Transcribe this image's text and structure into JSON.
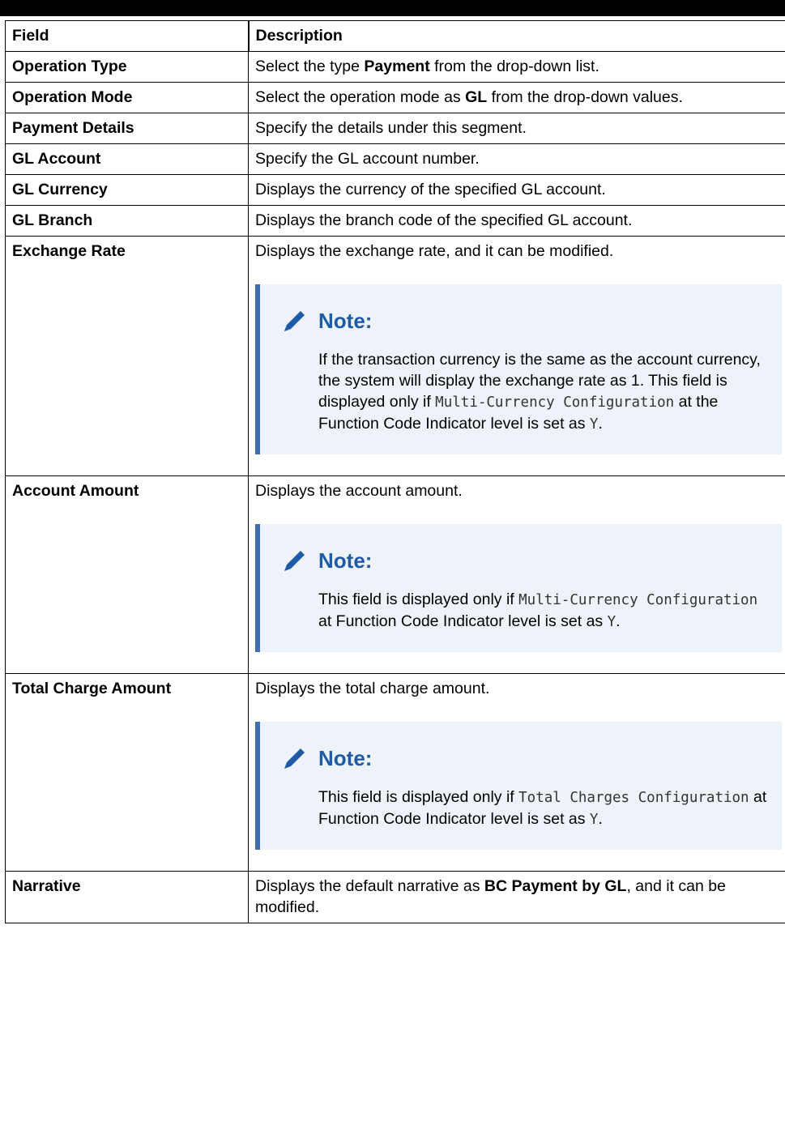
{
  "table": {
    "header": {
      "field": "Field",
      "description": "Description"
    },
    "rows": [
      {
        "field": "Operation Type",
        "d1": "Select the type ",
        "d2": "Payment",
        "d3": " from the drop-down list."
      },
      {
        "field": "Operation Mode",
        "d1": "Select the operation mode as ",
        "d2": "GL",
        "d3": " from the drop-down values."
      },
      {
        "field": "Payment Details",
        "d1": "Specify the details under this segment."
      },
      {
        "field": "GL Account",
        "d1": "Specify the GL account number."
      },
      {
        "field": "GL Currency",
        "d1": "Displays the currency of the specified GL account."
      },
      {
        "field": "GL Branch",
        "d1": "Displays the branch code of the specified GL account."
      },
      {
        "field": "Exchange Rate",
        "d1": "Displays the exchange rate, and it can be modified.",
        "note": {
          "title": "Note:",
          "t1": "If the transaction currency is the same as the account currency, the system will display the exchange rate as 1. This field is displayed only if ",
          "code1": "Multi-Currency Configuration",
          "t2": " at the Function Code Indicator level is set as ",
          "code2": "Y",
          "t3": "."
        }
      },
      {
        "field": "Account Amount",
        "d1": "Displays the account amount.",
        "note": {
          "title": "Note:",
          "t1": "This field is displayed only if ",
          "code1": "Multi-Currency Configuration",
          "t2": " at Function Code Indicator level is set as ",
          "code2": "Y",
          "t3": "."
        }
      },
      {
        "field": "Total Charge Amount",
        "d1": "Displays the total charge amount.",
        "note": {
          "title": "Note:",
          "t1": "This field is displayed only if ",
          "code1": "Total Charges Configuration",
          "t2": " at Function Code Indicator level is set as ",
          "code2": "Y",
          "t3": "."
        }
      },
      {
        "field": "Narrative",
        "d1": "Displays the default narrative as ",
        "d2": "BC Payment by GL",
        "d3": ", and it can be modified."
      }
    ]
  },
  "icons": {
    "note": "pencil-icon"
  },
  "colors": {
    "note_title": "#1f5ba5",
    "note_bar": "#3f6fb1",
    "note_bg": "#eef3f9"
  }
}
